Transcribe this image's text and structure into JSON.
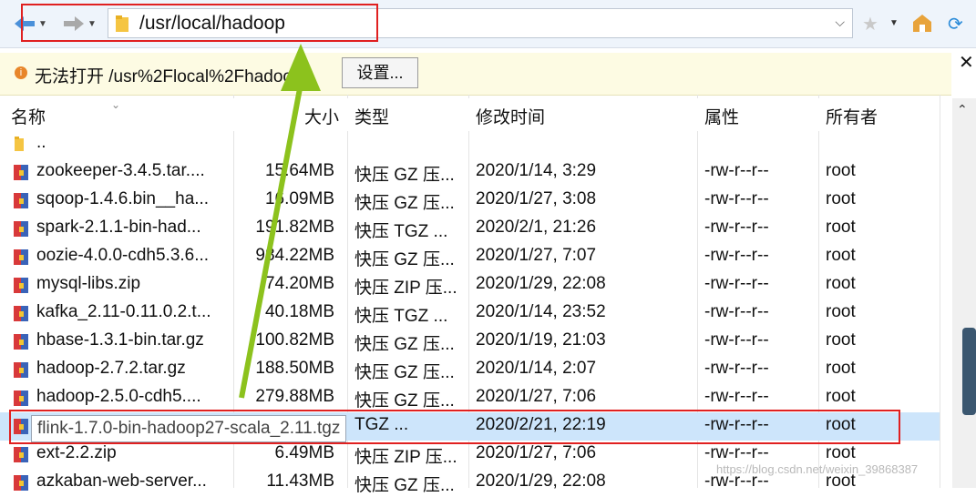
{
  "toolbar": {
    "address_path": "/usr/local/hadoop",
    "back_icon": "arrow-left-icon",
    "forward_icon": "arrow-right-icon",
    "folder_icon": "folder-icon"
  },
  "infobar": {
    "message": "无法打开 /usr%2Flocal%2Fhadoop",
    "settings_label": "设置..."
  },
  "columns": {
    "name": "名称",
    "size": "大小",
    "type": "类型",
    "modified": "修改时间",
    "attributes": "属性",
    "owner": "所有者"
  },
  "rows": [
    {
      "name": "..",
      "size": "",
      "type": "",
      "modified": "",
      "attr": "",
      "owner": "",
      "icon": "folder-icon"
    },
    {
      "name": "zookeeper-3.4.5.tar....",
      "size": "15.64MB",
      "type": "快压 GZ 压...",
      "modified": "2020/1/14, 3:29",
      "attr": "-rw-r--r--",
      "owner": "root",
      "icon": "archive-icon"
    },
    {
      "name": "sqoop-1.4.6.bin__ha...",
      "size": "16.09MB",
      "type": "快压 GZ 压...",
      "modified": "2020/1/27, 3:08",
      "attr": "-rw-r--r--",
      "owner": "root",
      "icon": "archive-icon"
    },
    {
      "name": "spark-2.1.1-bin-had...",
      "size": "191.82MB",
      "type": "快压 TGZ ...",
      "modified": "2020/2/1, 21:26",
      "attr": "-rw-r--r--",
      "owner": "root",
      "icon": "archive-icon"
    },
    {
      "name": "oozie-4.0.0-cdh5.3.6...",
      "size": "984.22MB",
      "type": "快压 GZ 压...",
      "modified": "2020/1/27, 7:07",
      "attr": "-rw-r--r--",
      "owner": "root",
      "icon": "archive-icon"
    },
    {
      "name": "mysql-libs.zip",
      "size": "74.20MB",
      "type": "快压 ZIP 压...",
      "modified": "2020/1/29, 22:08",
      "attr": "-rw-r--r--",
      "owner": "root",
      "icon": "archive-icon"
    },
    {
      "name": "kafka_2.11-0.11.0.2.t...",
      "size": "40.18MB",
      "type": "快压 TGZ ...",
      "modified": "2020/1/14, 23:52",
      "attr": "-rw-r--r--",
      "owner": "root",
      "icon": "archive-icon"
    },
    {
      "name": "hbase-1.3.1-bin.tar.gz",
      "size": "100.82MB",
      "type": "快压 GZ 压...",
      "modified": "2020/1/19, 21:03",
      "attr": "-rw-r--r--",
      "owner": "root",
      "icon": "archive-icon"
    },
    {
      "name": "hadoop-2.7.2.tar.gz",
      "size": "188.50MB",
      "type": "快压 GZ 压...",
      "modified": "2020/1/14, 2:07",
      "attr": "-rw-r--r--",
      "owner": "root",
      "icon": "archive-icon"
    },
    {
      "name": "hadoop-2.5.0-cdh5....",
      "size": "279.88MB",
      "type": "快压 GZ 压...",
      "modified": "2020/1/27, 7:06",
      "attr": "-rw-r--r--",
      "owner": "root",
      "icon": "archive-icon"
    },
    {
      "name": "",
      "size": "",
      "type": "TGZ ...",
      "modified": "2020/2/21, 22:19",
      "attr": "-rw-r--r--",
      "owner": "root",
      "icon": "archive-icon"
    },
    {
      "name": "ext-2.2.zip",
      "size": "6.49MB",
      "type": "快压 ZIP 压...",
      "modified": "2020/1/27, 7:06",
      "attr": "-rw-r--r--",
      "owner": "root",
      "icon": "archive-icon"
    },
    {
      "name": "azkaban-web-server...",
      "size": "11.43MB",
      "type": "快压 GZ 压...",
      "modified": "2020/1/29, 22:08",
      "attr": "-rw-r--r--",
      "owner": "root",
      "icon": "archive-icon"
    }
  ],
  "tooltip": "flink-1.7.0-bin-hadoop27-scala_2.11.tgz",
  "watermark": "https://blog.csdn.net/weixin_39868387",
  "colors": {
    "annotation_red": "#e02020",
    "arrow_green": "#8cc21d",
    "selection": "#cde5fb"
  }
}
